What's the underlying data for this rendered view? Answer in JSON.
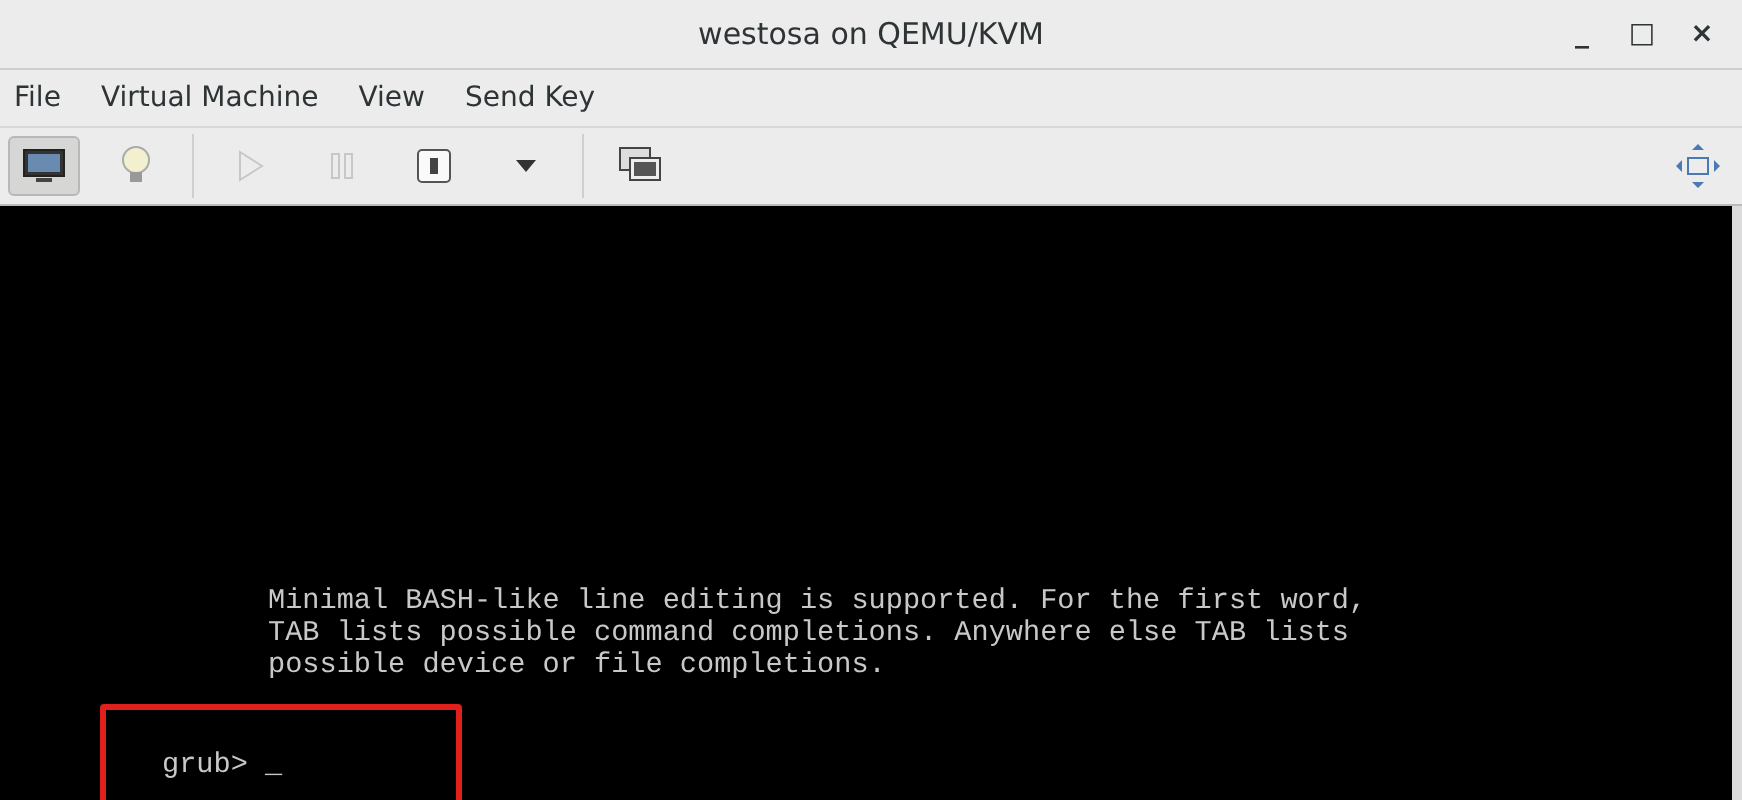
{
  "window": {
    "title": "westosa on QEMU/KVM",
    "controls": [
      "_",
      "□",
      "×"
    ]
  },
  "menu": [
    "File",
    "Virtual Machine",
    "View",
    "Send Key"
  ],
  "toolbar": [
    {
      "kind": "monitor",
      "selected": true,
      "disabled": false
    },
    {
      "kind": "bulb",
      "selected": false,
      "disabled": false
    },
    {
      "kind": "sep"
    },
    {
      "kind": "play",
      "selected": false,
      "disabled": true
    },
    {
      "kind": "pause",
      "selected": false,
      "disabled": true
    },
    {
      "kind": "power",
      "selected": false,
      "disabled": false
    },
    {
      "kind": "caret",
      "selected": false,
      "disabled": false
    },
    {
      "kind": "sep"
    },
    {
      "kind": "screens",
      "selected": false,
      "disabled": false
    },
    {
      "kind": "spacer"
    },
    {
      "kind": "fullscreen",
      "selected": false,
      "disabled": false
    }
  ],
  "console": {
    "lines": [
      "Minimal BASH-like line editing is supported. For the first word,",
      "TAB lists possible command completions. Anywhere else TAB lists",
      "possible device or file completions."
    ],
    "prompt": "grub> _",
    "highlighted": true
  }
}
